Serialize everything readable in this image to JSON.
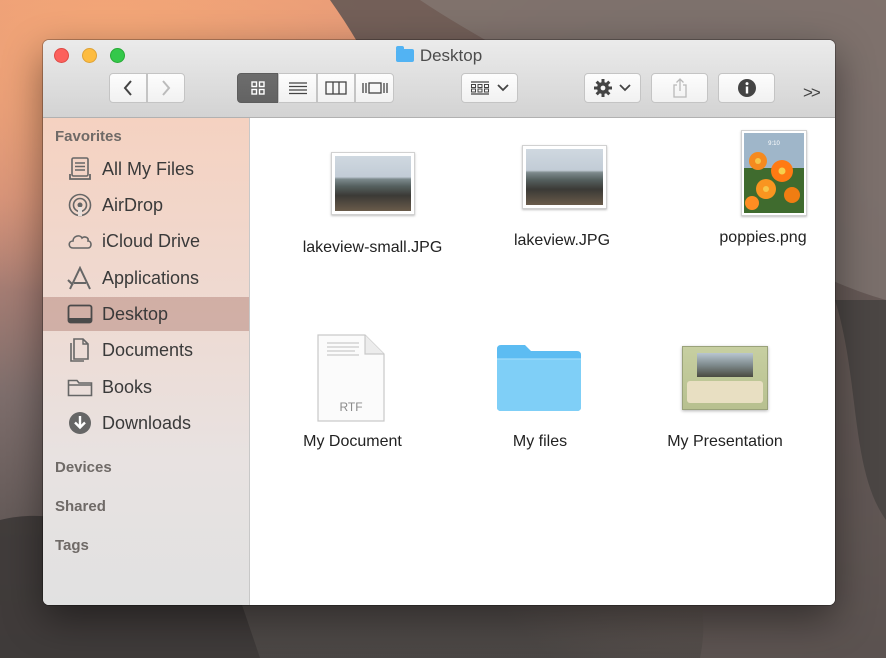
{
  "window": {
    "title": "Desktop",
    "controls": {
      "close": "close",
      "minimize": "minimize",
      "zoom": "zoom"
    }
  },
  "toolbar": {
    "back_icon": "chevron-left-icon",
    "forward_icon": "chevron-right-icon",
    "view_modes": [
      "icon-view",
      "list-view",
      "column-view",
      "cover-flow-view"
    ],
    "active_view": "icon-view",
    "arrange_icon": "arrange-grid-icon",
    "action_icon": "gear-icon",
    "share_icon": "share-icon",
    "info_icon": "info-icon",
    "overflow": ">>"
  },
  "sidebar": {
    "favorites_heading": "Favorites",
    "items": [
      {
        "label": "All My Files",
        "icon": "all-files-icon"
      },
      {
        "label": "AirDrop",
        "icon": "airdrop-icon"
      },
      {
        "label": "iCloud Drive",
        "icon": "cloud-icon"
      },
      {
        "label": "Applications",
        "icon": "applications-icon"
      },
      {
        "label": "Desktop",
        "icon": "desktop-icon",
        "selected": true
      },
      {
        "label": "Documents",
        "icon": "documents-icon"
      },
      {
        "label": "Books",
        "icon": "folder-icon"
      },
      {
        "label": "Downloads",
        "icon": "download-icon"
      }
    ],
    "devices_heading": "Devices",
    "shared_heading": "Shared",
    "tags_heading": "Tags"
  },
  "files": [
    {
      "name": "lakeview-small.JPG",
      "kind": "photo"
    },
    {
      "name": "lakeview.JPG",
      "kind": "photo"
    },
    {
      "name": "poppies.png",
      "kind": "image-portrait"
    },
    {
      "name": "My Document",
      "kind": "rtf",
      "badge": "RTF"
    },
    {
      "name": "My files",
      "kind": "folder"
    },
    {
      "name": "My Presentation",
      "kind": "presentation"
    }
  ],
  "colors": {
    "selection": "#c79a8e",
    "folder_blue": "#6cc6f5",
    "close": "#fc605c",
    "minimize": "#fdbc40",
    "zoom": "#34c84a"
  }
}
